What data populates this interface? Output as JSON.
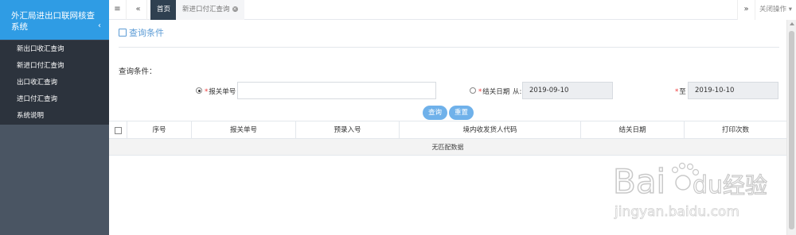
{
  "sidebar": {
    "title": "外汇局进出口联网核查系统",
    "collapse_icon": "‹",
    "items": [
      {
        "label": "新出口收汇查询"
      },
      {
        "label": "新进口付汇查询"
      },
      {
        "label": "出口收汇查询"
      },
      {
        "label": "进口付汇查询"
      },
      {
        "label": "系统说明"
      }
    ]
  },
  "tabbar": {
    "menu_icon": "≡",
    "back_icon": "«",
    "tabs": [
      {
        "label": "首页"
      },
      {
        "label": "新进口付汇查询"
      }
    ],
    "forward_icon": "»",
    "close_ops_label": "关闭操作"
  },
  "panel": {
    "title": "查询条件",
    "section_label": "查询条件："
  },
  "form": {
    "declaration_no": {
      "required_mark": "*",
      "label": "报关单号",
      "value": "",
      "checked": true
    },
    "clearance_date": {
      "required_mark": "*",
      "label": "结关日期",
      "from_label": "从:",
      "from_value": "2019-09-10",
      "to_label": "至",
      "to_value": "2019-10-10",
      "checked": false
    },
    "buttons": {
      "query": "查询",
      "reset": "重置"
    }
  },
  "table": {
    "columns": [
      "序号",
      "报关单号",
      "预录入号",
      "境内收发货人代码",
      "结关日期",
      "打印次数"
    ],
    "empty_text": "无匹配数据"
  },
  "watermark": {
    "brand": "Bai",
    "brand2": "du",
    "cn": "经验",
    "url": "jingyan.baidu.com"
  },
  "colors": {
    "accent": "#2f9ce4",
    "sidebar_bg": "#3a4350",
    "button": "#6fb1ea"
  }
}
